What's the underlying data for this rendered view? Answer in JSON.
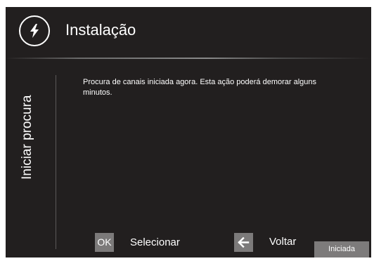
{
  "header": {
    "title": "Instalação",
    "logo_icon": "lightning-bolt-icon"
  },
  "side_panel": {
    "label": "Iniciar procura"
  },
  "content": {
    "message": "Procura de canais iniciada agora. Esta ação poderá demorar alguns minutos."
  },
  "footer": {
    "ok_key": "OK",
    "select_label": "Selecionar",
    "back_icon": "arrow-left-icon",
    "back_label": "Voltar",
    "status": "Iniciada"
  },
  "colors": {
    "background": "#221f1f",
    "key_background": "#7c7a7a",
    "text": "#ffffff"
  }
}
